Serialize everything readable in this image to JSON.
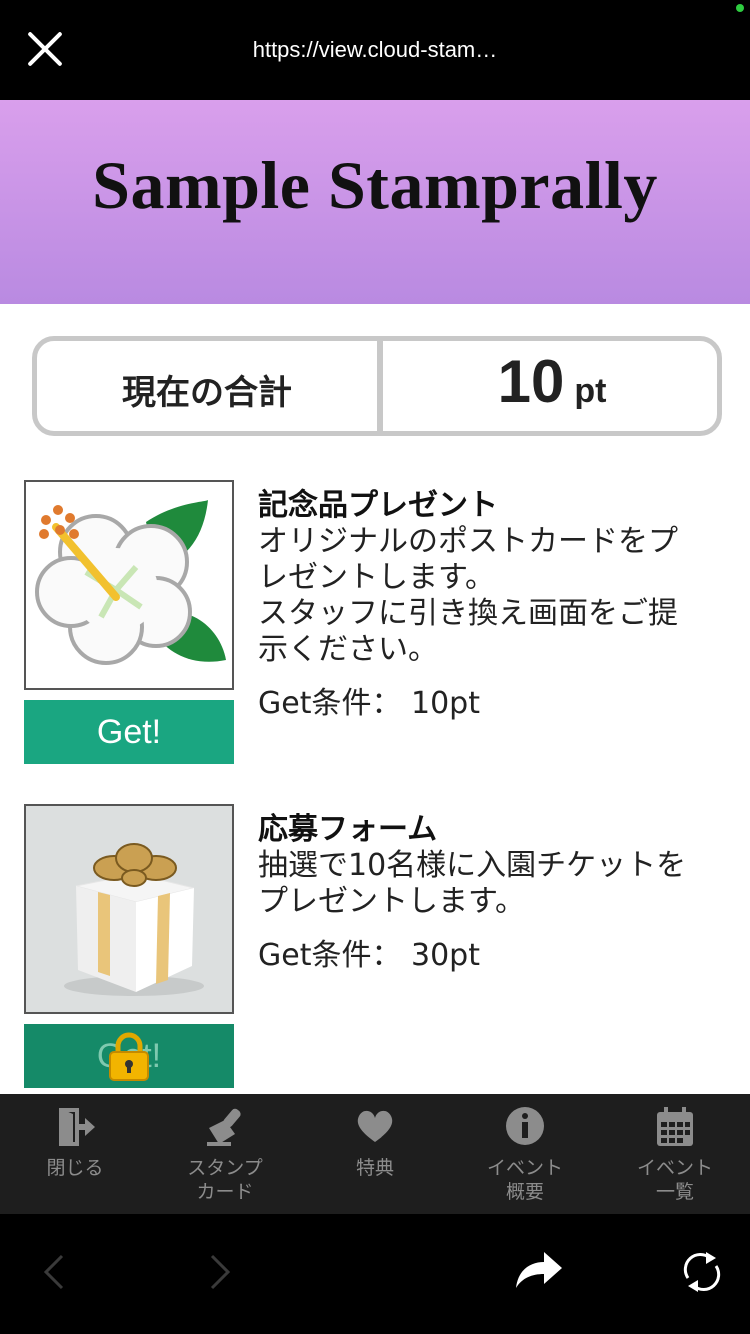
{
  "browser": {
    "url": "https://view.cloud-stam…"
  },
  "header": {
    "title": "Sample Stamprally"
  },
  "points": {
    "label": "現在の合計",
    "value": "10",
    "unit": "pt"
  },
  "rewards": [
    {
      "title": "記念品プレゼント",
      "description": "オリジナルのポストカードをプ\nレゼントします。\nスタッフに引き換え画面をご提\n示ください。",
      "condition": "Get条件：  10pt",
      "button_label": "Get!",
      "locked": false
    },
    {
      "title": "応募フォーム",
      "description": "抽選で10名様に入園チケットを\nプレゼントします。",
      "condition": "Get条件：  30pt",
      "button_label": "Get!",
      "locked": true
    }
  ],
  "tabbar": {
    "items": [
      {
        "label": "閉じる",
        "icon": "exit-icon"
      },
      {
        "label": "スタンプ\nカード",
        "icon": "stamp-icon"
      },
      {
        "label": "特典",
        "icon": "heart-icon"
      },
      {
        "label": "イベント\n概要",
        "icon": "info-icon"
      },
      {
        "label": "イベント\n一覧",
        "icon": "calendar-icon"
      }
    ]
  },
  "colors": {
    "banner_top": "#d99fec",
    "banner_bottom": "#b98ae1",
    "get_button": "#1aa681",
    "tabbar_bg": "#1e1e1e"
  }
}
